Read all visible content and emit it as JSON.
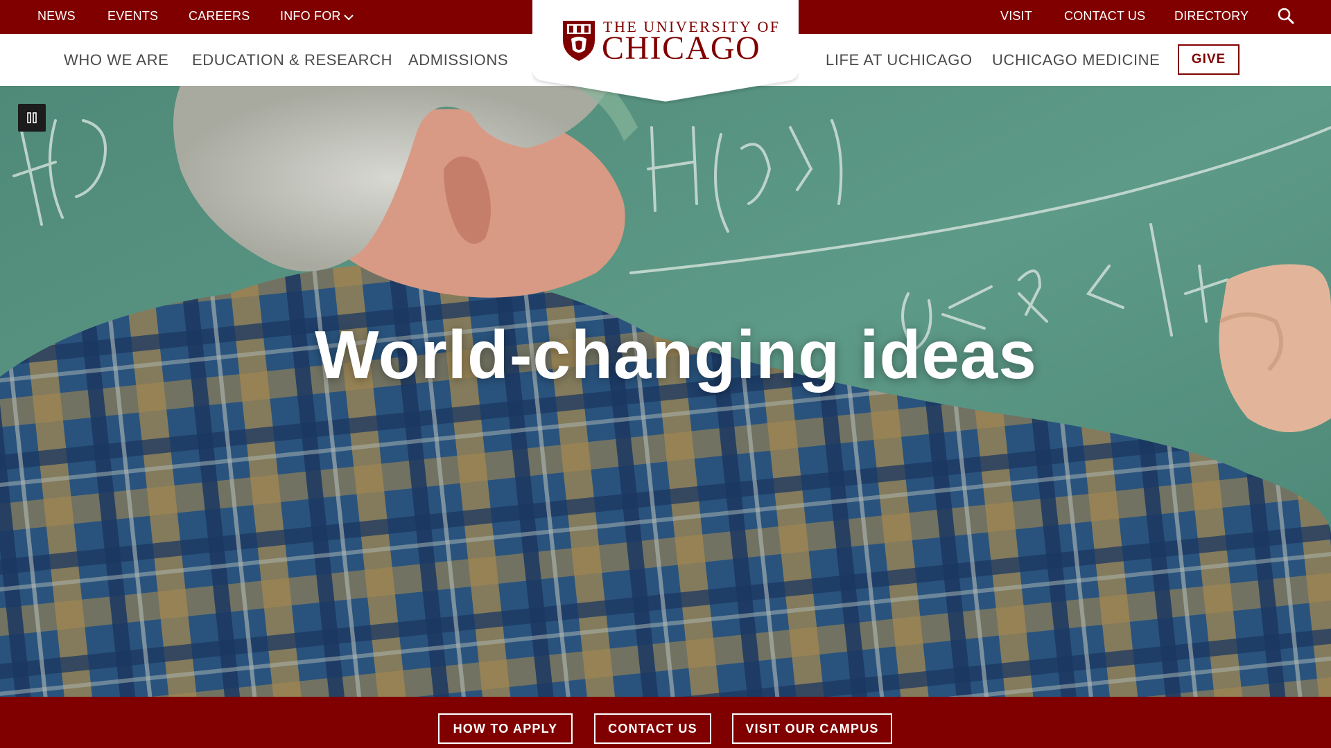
{
  "utility_nav": {
    "news": "NEWS",
    "events": "EVENTS",
    "careers": "CAREERS",
    "info_for": "INFO FOR",
    "visit": "VISIT",
    "contact_us": "CONTACT US",
    "directory": "DIRECTORY",
    "search_icon": "search-icon"
  },
  "logo": {
    "line1": "THE UNIVERSITY OF",
    "line2": "CHICAGO",
    "icon": "shield-icon"
  },
  "main_nav": {
    "who_we_are": "WHO WE ARE",
    "education_research": "EDUCATION & RESEARCH",
    "admissions": "ADMISSIONS",
    "life_at_uchicago": "LIFE AT UCHICAGO",
    "uchicago_medicine": "UCHICAGO MEDICINE",
    "give": "GIVE"
  },
  "hero": {
    "title": "World-changing ideas",
    "pause_icon": "pause-icon"
  },
  "cta": {
    "how_to_apply": "HOW TO APPLY",
    "contact_us": "CONTACT US",
    "visit_our_campus": "VISIT OUR CAMPUS"
  },
  "colors": {
    "maroon": "#800000",
    "white": "#ffffff",
    "nav_text": "#4a4a4a"
  }
}
